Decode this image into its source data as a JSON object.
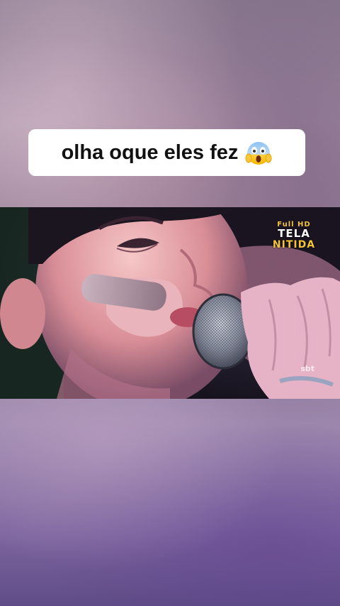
{
  "caption": {
    "text": "olha oque eles fez",
    "emoji": "face-screaming-in-fear-icon"
  },
  "video": {
    "watermark_top": "Full HD",
    "watermark_line1": "TELA",
    "watermark_line2": "NITIDA",
    "channel_logo": "sbt"
  },
  "colors": {
    "background": "#9a8399",
    "caption_bg": "#ffffff",
    "caption_text": "#111111",
    "watermark_yellow": "#f3c536"
  }
}
